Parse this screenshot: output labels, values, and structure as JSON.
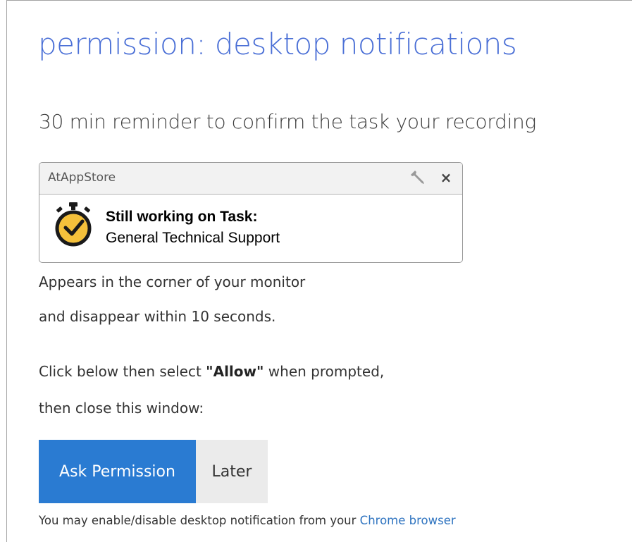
{
  "page": {
    "title": "permission: desktop notifications",
    "subtitle": "30 min reminder to confirm the task your recording"
  },
  "notification_preview": {
    "app_name": "AtAppStore",
    "title": "Still working on Task:",
    "message": "General Technical Support",
    "settings_icon": "wrench-icon",
    "close_label": "×",
    "image_icon": "stopwatch-icon"
  },
  "description": {
    "line1": "Appears in the corner of your monitor",
    "line2": "and disappear within 10 seconds."
  },
  "instructions": {
    "prefix": "Click below then select ",
    "emphasis": "\"Allow\"",
    "suffix": " when prompted,",
    "line2": "then close this window:"
  },
  "buttons": {
    "ask_permission": "Ask Permission",
    "later": "Later"
  },
  "footer": {
    "text": "You may enable/disable desktop notification from your ",
    "link": "Chrome browser"
  },
  "colors": {
    "title": "#4a6fd6",
    "primary_button": "#2a7bd2",
    "secondary_button": "#ebebeb",
    "link": "#2f74c0",
    "stopwatch_fill": "#f5c13b"
  }
}
